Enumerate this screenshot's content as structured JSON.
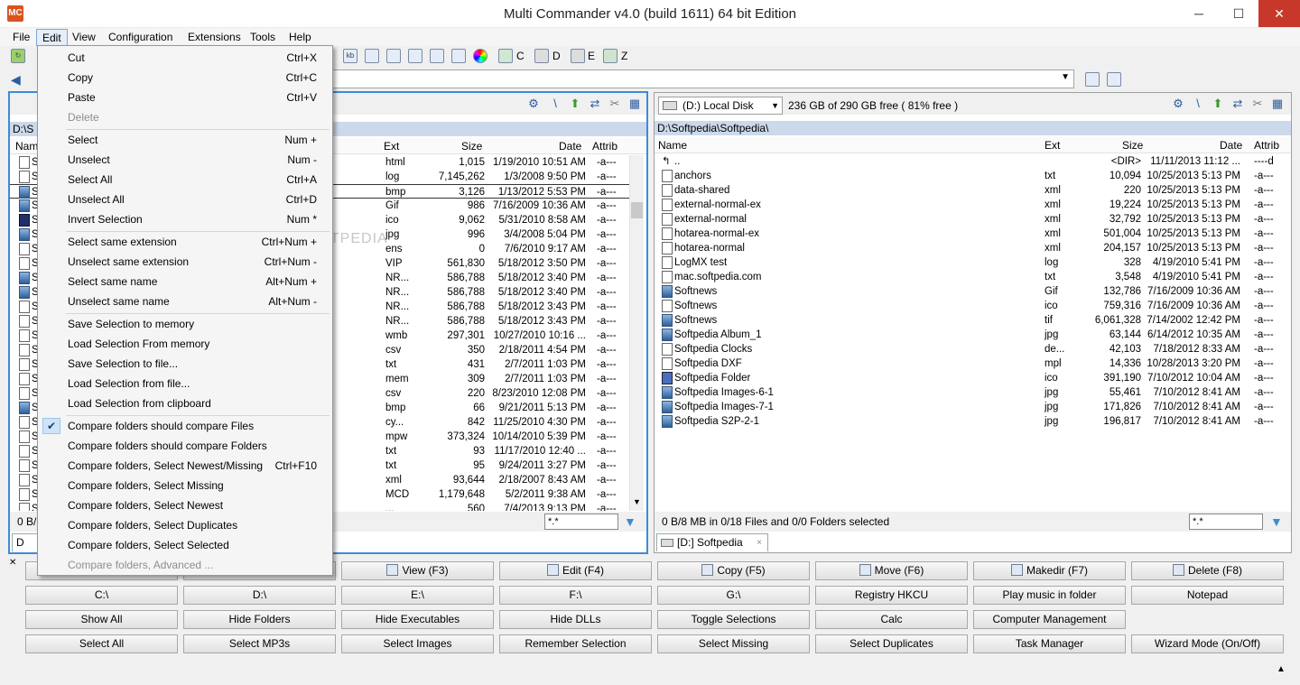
{
  "window": {
    "title": "Multi Commander v4.0 (build 1611) 64 bit Edition",
    "icon": "app-icon",
    "min": "─",
    "max": "☐",
    "close": "✕"
  },
  "menu": [
    "File",
    "Edit",
    "View",
    "Configuration",
    "Extensions",
    "Tools",
    "Help"
  ],
  "toolbar": {
    "drives": [
      "C",
      "D",
      "E",
      "Z"
    ]
  },
  "edit_menu": [
    {
      "label": "Cut",
      "shortcut": "Ctrl+X"
    },
    {
      "label": "Copy",
      "shortcut": "Ctrl+C"
    },
    {
      "label": "Paste",
      "shortcut": "Ctrl+V"
    },
    {
      "label": "Delete",
      "shortcut": "",
      "disabled": true
    },
    {
      "sep": true
    },
    {
      "label": "Select",
      "shortcut": "Num +"
    },
    {
      "label": "Unselect",
      "shortcut": "Num -"
    },
    {
      "label": "Select All",
      "shortcut": "Ctrl+A"
    },
    {
      "label": "Unselect All",
      "shortcut": "Ctrl+D"
    },
    {
      "label": "Invert Selection",
      "shortcut": "Num *"
    },
    {
      "sep": true
    },
    {
      "label": "Select same extension",
      "shortcut": "Ctrl+Num +"
    },
    {
      "label": "Unselect same extension",
      "shortcut": "Ctrl+Num -"
    },
    {
      "label": "Select same name",
      "shortcut": "Alt+Num +"
    },
    {
      "label": "Unselect same name",
      "shortcut": "Alt+Num -"
    },
    {
      "sep": true
    },
    {
      "label": "Save Selection to memory",
      "shortcut": ""
    },
    {
      "label": "Load Selection From memory",
      "shortcut": ""
    },
    {
      "label": "Save Selection to file...",
      "shortcut": ""
    },
    {
      "label": "Load Selection from file...",
      "shortcut": ""
    },
    {
      "label": "Load Selection from clipboard",
      "shortcut": ""
    },
    {
      "sep": true
    },
    {
      "label": "Compare folders should compare Files",
      "shortcut": "",
      "checked": true
    },
    {
      "label": "Compare folders should compare Folders",
      "shortcut": ""
    },
    {
      "label": "Compare folders, Select Newest/Missing",
      "shortcut": "Ctrl+F10"
    },
    {
      "label": "Compare folders, Select Missing",
      "shortcut": ""
    },
    {
      "label": "Compare folders, Select Newest",
      "shortcut": ""
    },
    {
      "label": "Compare folders, Select Duplicates",
      "shortcut": ""
    },
    {
      "label": "Compare folders, Select Selected",
      "shortcut": ""
    },
    {
      "label": "Compare folders, Advanced ...",
      "shortcut": "",
      "disabled": true
    }
  ],
  "left_panel": {
    "path": "D:\\S",
    "columns": {
      "name": "Name",
      "ext": "Ext",
      "size": "Size",
      "date": "Date",
      "attrib": "Attrib"
    },
    "rows": [
      {
        "n": "S",
        "ext": "html",
        "size": "1,015",
        "date": "1/19/2010 10:51 AM",
        "attr": "-a---",
        "icon": "doc"
      },
      {
        "n": "S",
        "ext": "log",
        "size": "7,145,262",
        "date": "1/3/2008 9:50 PM",
        "attr": "-a---",
        "icon": "doc"
      },
      {
        "n": "S",
        "ext": "bmp",
        "size": "3,126",
        "date": "1/13/2012 5:53 PM",
        "attr": "-a---",
        "icon": "img"
      },
      {
        "n": "S",
        "ext": "Gif",
        "size": "986",
        "date": "7/16/2009 10:36 AM",
        "attr": "-a---",
        "icon": "img"
      },
      {
        "n": "S",
        "ext": "ico",
        "size": "9,062",
        "date": "5/31/2010 8:58 AM",
        "attr": "-a---",
        "icon": "s"
      },
      {
        "n": "S",
        "ext": "jpg",
        "size": "996",
        "date": "3/4/2008 5:04 PM",
        "attr": "-a---",
        "icon": "img"
      },
      {
        "n": "S",
        "ext": "ens",
        "size": "0",
        "date": "7/6/2010 9:17 AM",
        "attr": "-a---",
        "icon": "doc"
      },
      {
        "n": "S",
        "ext": "VIP",
        "size": "561,830",
        "date": "5/18/2012 3:50 PM",
        "attr": "-a---",
        "icon": "doc"
      },
      {
        "n": "S",
        "ext": "NR...",
        "size": "586,788",
        "date": "5/18/2012 3:40 PM",
        "attr": "-a---",
        "icon": "img"
      },
      {
        "n": "S",
        "ext": "NR...",
        "size": "586,788",
        "date": "5/18/2012 3:40 PM",
        "attr": "-a---",
        "icon": "img"
      },
      {
        "n": "S",
        "ext": "NR...",
        "size": "586,788",
        "date": "5/18/2012 3:43 PM",
        "attr": "-a---",
        "icon": "doc"
      },
      {
        "n": "S",
        "ext": "NR...",
        "size": "586,788",
        "date": "5/18/2012 3:43 PM",
        "attr": "-a---",
        "icon": "doc"
      },
      {
        "n": "S",
        "ext": "wmb",
        "size": "297,301",
        "date": "10/27/2010 10:16 ...",
        "attr": "-a---",
        "icon": "doc"
      },
      {
        "n": "S",
        "ext": "csv",
        "size": "350",
        "date": "2/18/2011 4:54 PM",
        "attr": "-a---",
        "icon": "doc"
      },
      {
        "n": "S",
        "ext": "txt",
        "size": "431",
        "date": "2/7/2011 1:03 PM",
        "attr": "-a---",
        "icon": "doc"
      },
      {
        "n": "S",
        "ext": "mem",
        "size": "309",
        "date": "2/7/2011 1:03 PM",
        "attr": "-a---",
        "icon": "doc"
      },
      {
        "n": "S",
        "ext": "csv",
        "size": "220",
        "date": "8/23/2010 12:08 PM",
        "attr": "-a---",
        "icon": "doc"
      },
      {
        "n": "S",
        "ext": "bmp",
        "size": "66",
        "date": "9/21/2011 5:13 PM",
        "attr": "-a---",
        "icon": "img"
      },
      {
        "n": "S",
        "ext": "cy...",
        "size": "842",
        "date": "11/25/2010 4:30 PM",
        "attr": "-a---",
        "icon": "doc"
      },
      {
        "n": "S",
        "ext": "mpw",
        "size": "373,324",
        "date": "10/14/2010 5:39 PM",
        "attr": "-a---",
        "icon": "doc"
      },
      {
        "n": "S",
        "ext": "txt",
        "size": "93",
        "date": "11/17/2010 12:40 ...",
        "attr": "-a---",
        "icon": "doc"
      },
      {
        "n": "S",
        "ext": "txt",
        "size": "95",
        "date": "9/24/2011 3:27 PM",
        "attr": "-a---",
        "icon": "doc"
      },
      {
        "n": "S",
        "ext": "xml",
        "size": "93,644",
        "date": "2/18/2007 8:43 AM",
        "attr": "-a---",
        "icon": "doc"
      },
      {
        "n": "S",
        "ext": "MCD",
        "size": "1,179,648",
        "date": "5/2/2011 9:38 AM",
        "attr": "-a---",
        "icon": "doc"
      },
      {
        "n": "S",
        "ext": "...",
        "size": "560",
        "date": "7/4/2013 9:13 PM",
        "attr": "-a---",
        "icon": "doc"
      }
    ],
    "status": "0 B/",
    "filter": "*.*",
    "tab": "D"
  },
  "right_panel": {
    "drive": "(D:) Local Disk",
    "free": "236 GB of 290 GB free ( 81% free )",
    "path": "D:\\Softpedia\\Softpedia\\",
    "columns": {
      "name": "Name",
      "ext": "Ext",
      "size": "Size",
      "date": "Date",
      "attrib": "Attrib"
    },
    "rows": [
      {
        "n": "..",
        "ext": "",
        "size": "<DIR>",
        "date": "11/11/2013 11:12 ...",
        "attr": "----d",
        "icon": "up"
      },
      {
        "n": "anchors",
        "ext": "txt",
        "size": "10,094",
        "date": "10/25/2013 5:13 PM",
        "attr": "-a---",
        "icon": "doc"
      },
      {
        "n": "data-shared",
        "ext": "xml",
        "size": "220",
        "date": "10/25/2013 5:13 PM",
        "attr": "-a---",
        "icon": "doc"
      },
      {
        "n": "external-normal-ex",
        "ext": "xml",
        "size": "19,224",
        "date": "10/25/2013 5:13 PM",
        "attr": "-a---",
        "icon": "doc"
      },
      {
        "n": "external-normal",
        "ext": "xml",
        "size": "32,792",
        "date": "10/25/2013 5:13 PM",
        "attr": "-a---",
        "icon": "doc"
      },
      {
        "n": "hotarea-normal-ex",
        "ext": "xml",
        "size": "501,004",
        "date": "10/25/2013 5:13 PM",
        "attr": "-a---",
        "icon": "doc"
      },
      {
        "n": "hotarea-normal",
        "ext": "xml",
        "size": "204,157",
        "date": "10/25/2013 5:13 PM",
        "attr": "-a---",
        "icon": "doc"
      },
      {
        "n": "LogMX test",
        "ext": "log",
        "size": "328",
        "date": "4/19/2010 5:41 PM",
        "attr": "-a---",
        "icon": "doc"
      },
      {
        "n": "mac.softpedia.com",
        "ext": "txt",
        "size": "3,548",
        "date": "4/19/2010 5:41 PM",
        "attr": "-a---",
        "icon": "doc"
      },
      {
        "n": "Softnews",
        "ext": "Gif",
        "size": "132,786",
        "date": "7/16/2009 10:36 AM",
        "attr": "-a---",
        "icon": "img"
      },
      {
        "n": "Softnews",
        "ext": "ico",
        "size": "759,316",
        "date": "7/16/2009 10:36 AM",
        "attr": "-a---",
        "icon": "doc"
      },
      {
        "n": "Softnews",
        "ext": "tif",
        "size": "6,061,328",
        "date": "7/14/2002 12:42 PM",
        "attr": "-a---",
        "icon": "img"
      },
      {
        "n": "Softpedia Album_1",
        "ext": "jpg",
        "size": "63,144",
        "date": "6/14/2012 10:35 AM",
        "attr": "-a---",
        "icon": "img"
      },
      {
        "n": "Softpedia Clocks",
        "ext": "de...",
        "size": "42,103",
        "date": "7/18/2012 8:33 AM",
        "attr": "-a---",
        "icon": "doc"
      },
      {
        "n": "Softpedia DXF",
        "ext": "mpl",
        "size": "14,336",
        "date": "10/28/2013 3:20 PM",
        "attr": "-a---",
        "icon": "doc"
      },
      {
        "n": "Softpedia Folder",
        "ext": "ico",
        "size": "391,190",
        "date": "7/10/2012 10:04 AM",
        "attr": "-a---",
        "icon": "folderi"
      },
      {
        "n": "Softpedia Images-6-1",
        "ext": "jpg",
        "size": "55,461",
        "date": "7/10/2012 8:41 AM",
        "attr": "-a---",
        "icon": "img"
      },
      {
        "n": "Softpedia Images-7-1",
        "ext": "jpg",
        "size": "171,826",
        "date": "7/10/2012 8:41 AM",
        "attr": "-a---",
        "icon": "img"
      },
      {
        "n": "Softpedia S2P-2-1",
        "ext": "jpg",
        "size": "196,817",
        "date": "7/10/2012 8:41 AM",
        "attr": "-a---",
        "icon": "img"
      }
    ],
    "status": "0 B/8 MB in 0/18 Files and 0/0 Folders selected",
    "filter": "*.*",
    "tab": "[D:] Softpedia"
  },
  "buttons": [
    [
      "",
      "",
      "View (F3)",
      "Edit (F4)",
      "Copy (F5)",
      "Move (F6)",
      "Makedir (F7)",
      "Delete (F8)"
    ],
    [
      "C:\\",
      "D:\\",
      "E:\\",
      "F:\\",
      "G:\\",
      "Registry HKCU",
      "Play music in folder",
      "Notepad"
    ],
    [
      "Show All",
      "Hide Folders",
      "Hide Executables",
      "Hide DLLs",
      "Toggle Selections",
      "Calc",
      "Computer Management"
    ],
    [
      "Select All",
      "Select MP3s",
      "Select Images",
      "Remember Selection",
      "Select Missing",
      "Select Duplicates",
      "Task Manager",
      "Wizard Mode (On/Off)"
    ]
  ],
  "watermark": "SOFTPEDIA"
}
